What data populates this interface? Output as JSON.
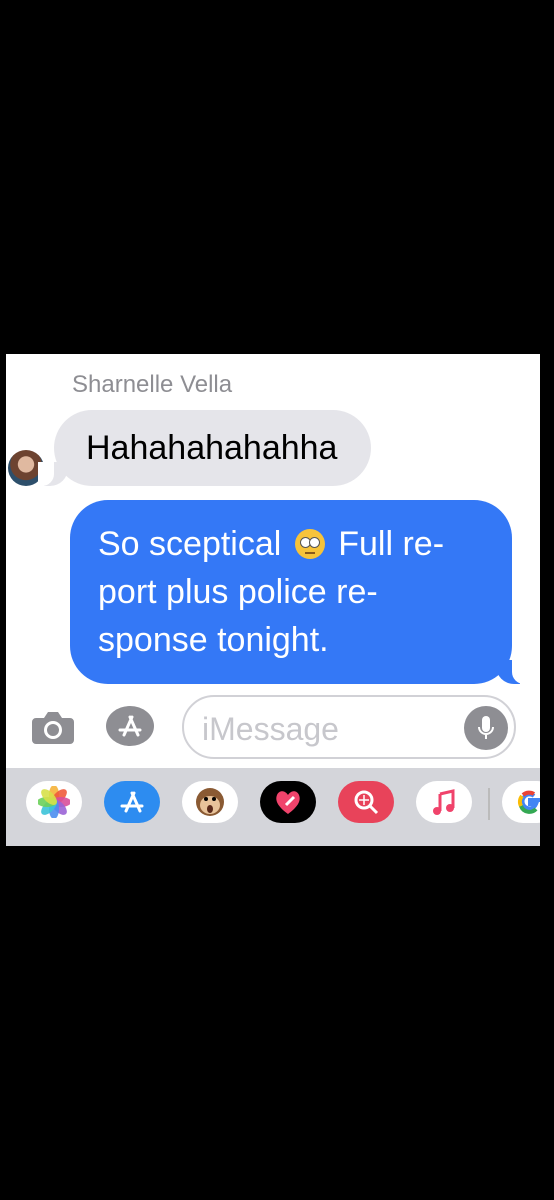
{
  "conversation": {
    "sender_name": "Sharnelle Vella",
    "incoming_message": "Hahahahahahha",
    "outgoing_message": {
      "part1": "So sceptical",
      "part2": "Full re-port plus police re-sponse tonight."
    }
  },
  "composer": {
    "placeholder": "iMessage",
    "camera_icon": "camera-icon",
    "apps_icon": "app-store-icon",
    "mic_icon": "microphone-icon"
  },
  "app_drawer": {
    "apps": [
      {
        "name": "photos-icon"
      },
      {
        "name": "app-store-icon"
      },
      {
        "name": "animoji-monkey-icon"
      },
      {
        "name": "digital-touch-heart-icon"
      },
      {
        "name": "web-image-search-icon"
      },
      {
        "name": "music-icon"
      },
      {
        "name": "google-icon"
      }
    ]
  },
  "colors": {
    "outgoing_bubble": "#3478f6",
    "incoming_bubble": "#e5e5ea",
    "app_drawer_bg": "#d4d5da"
  }
}
